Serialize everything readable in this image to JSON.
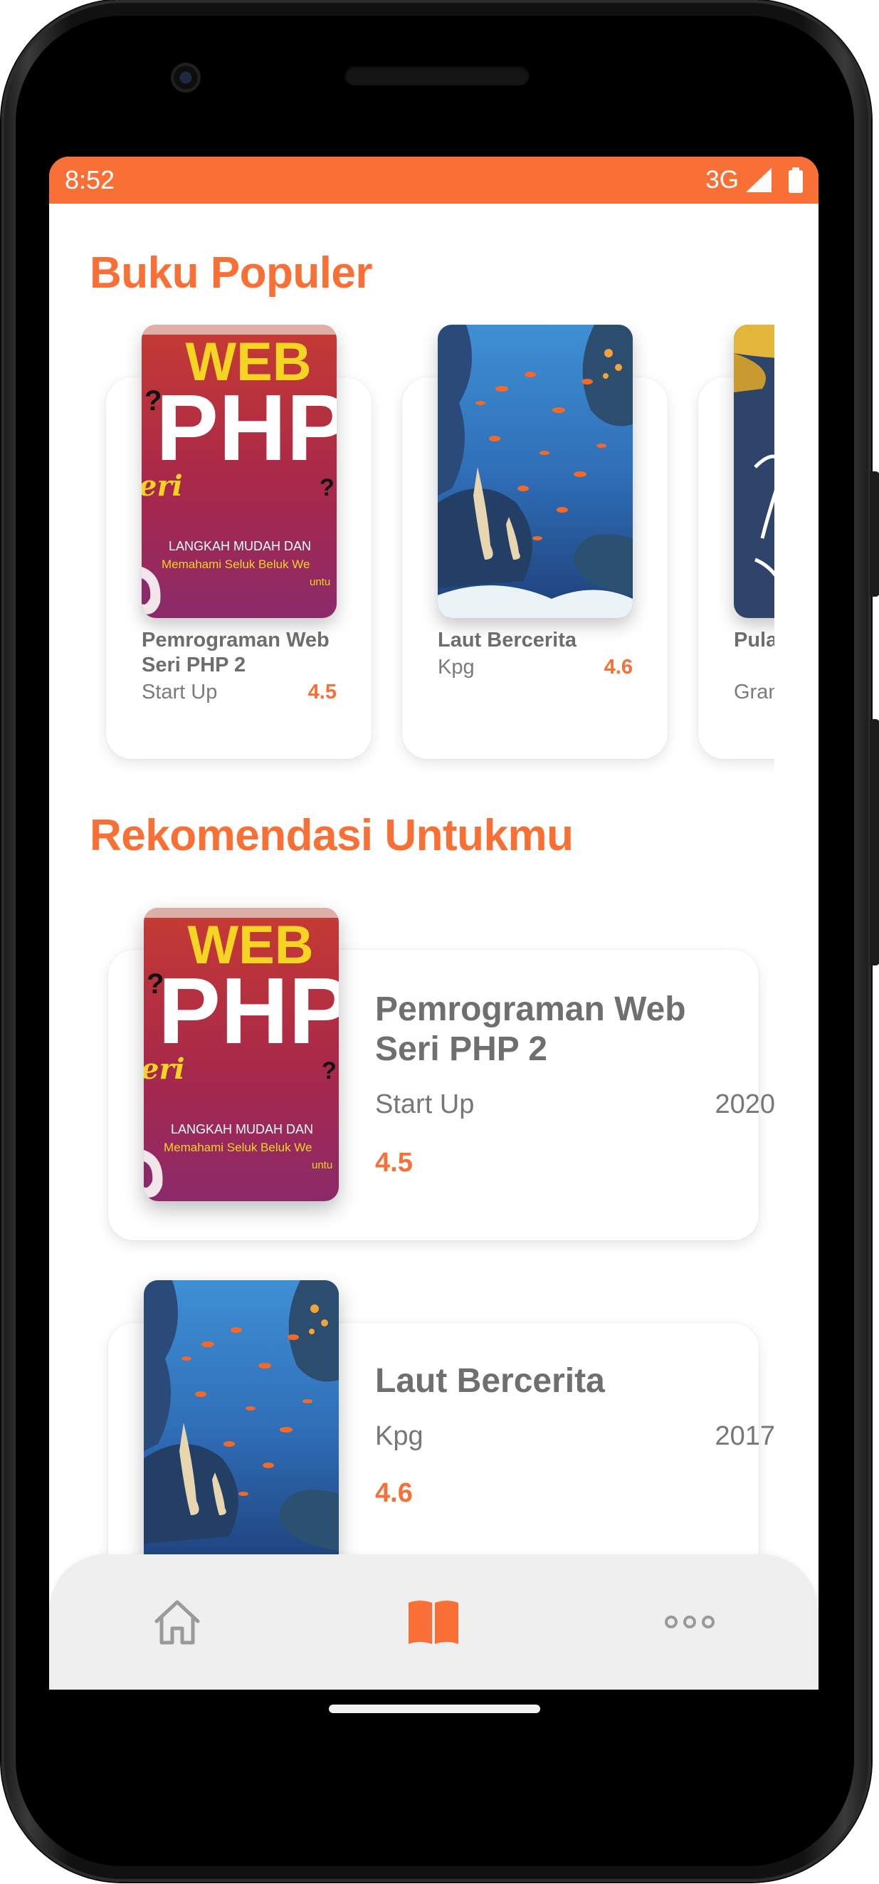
{
  "status_bar": {
    "time": "8:52",
    "network": "3G"
  },
  "sections": {
    "popular_title": "Buku Populer",
    "recommendation_title": "Rekomendasi Untukmu"
  },
  "popular_books": [
    {
      "title": "Pemrograman Web Seri PHP 2",
      "publisher": "Start Up",
      "rating": "4.5",
      "cover": "php-web-cover"
    },
    {
      "title": "Laut Bercerita",
      "publisher": "Kpg",
      "rating": "4.6",
      "cover": "underwater-cover"
    },
    {
      "title": "Pula (Cer",
      "publisher": "Gran",
      "rating": "",
      "cover": "blue-cover"
    }
  ],
  "recommended_books": [
    {
      "title": "Pemrograman Web Seri PHP 2",
      "publisher": "Start Up",
      "year": "2020",
      "rating": "4.5"
    },
    {
      "title": "Laut Bercerita",
      "publisher": "Kpg",
      "year": "2017",
      "rating": "4.6"
    }
  ],
  "php_cover_text": {
    "web": "WEB",
    "php": "PHP",
    "seri": "eri",
    "line1": "LANGKAH MUDAH DAN",
    "line2": "Memahami Seluk Beluk We",
    "line3": "untu"
  },
  "bottom_nav": [
    {
      "icon": "home-icon",
      "active": false
    },
    {
      "icon": "book-icon",
      "active": true
    },
    {
      "icon": "more-icon",
      "active": false
    }
  ],
  "colors": {
    "accent": "#F97036",
    "nav_background": "#EFEFEF",
    "inactive_icon": "#9a9a9a"
  }
}
